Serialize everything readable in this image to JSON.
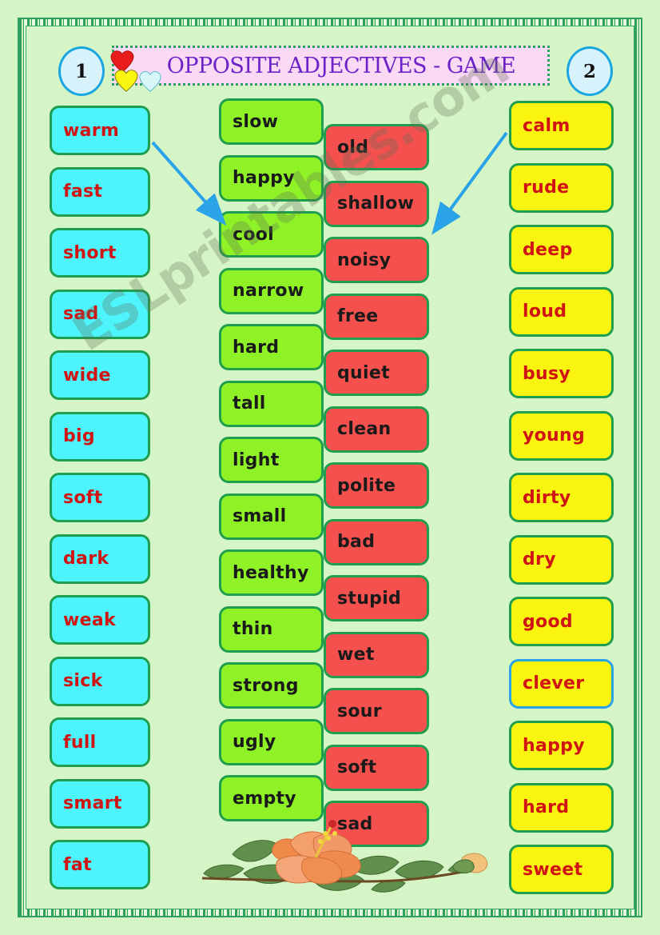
{
  "page": {
    "title": "OPPOSITE ADJECTIVES - GAME",
    "background_color": "#d6f5c6",
    "frame_color": "#2f9e5e",
    "watermark": "ESLprintables.com"
  },
  "header": {
    "title": "OPPOSITE ADJECTIVES - GAME",
    "title_color": "#6d21c9",
    "band_color": "#f9d9f4",
    "player_one": "1",
    "player_two": "2",
    "hearts": [
      {
        "name": "heart-red",
        "color": "#e81c1c"
      },
      {
        "name": "heart-yellow",
        "color": "#faf411"
      },
      {
        "name": "heart-white",
        "color": "#d8f7f9"
      }
    ]
  },
  "columns": [
    {
      "id": "column-cyan",
      "color": "#4df4fb",
      "text_color": "#d01414",
      "words": [
        "warm",
        "fast",
        "short",
        "sad",
        "wide",
        "big",
        "soft",
        "dark",
        "weak",
        "sick",
        "full",
        "smart",
        "fat"
      ]
    },
    {
      "id": "column-green",
      "color": "#8ef227",
      "text_color": "#1a1a1a",
      "words": [
        "slow",
        "happy",
        "cool",
        "narrow",
        "hard",
        "tall",
        "light",
        "small",
        "healthy",
        "thin",
        "strong",
        "ugly",
        "empty"
      ]
    },
    {
      "id": "column-red",
      "color": "#f4514e",
      "text_color": "#1a1a1a",
      "words": [
        "old",
        "shallow",
        "noisy",
        "free",
        "quiet",
        "clean",
        "polite",
        "bad",
        "stupid",
        "wet",
        "sour",
        "soft",
        "sad"
      ]
    },
    {
      "id": "column-yellow",
      "color": "#faf411",
      "text_color": "#d01414",
      "words": [
        "calm",
        "rude",
        "deep",
        "loud",
        "busy",
        "young",
        "dirty",
        "dry",
        "good",
        "clever",
        "happy",
        "hard",
        "sweet"
      ],
      "highlighted_word": "clever",
      "highlight_border_color": "#2aa3e8"
    }
  ],
  "arrows": [
    {
      "name": "arrow-warm-to-cool",
      "from": "warm",
      "to": "cool",
      "color": "#2aa3e8"
    },
    {
      "name": "arrow-calm-to-noisy",
      "from": "calm",
      "to": "noisy",
      "color": "#2aa3e8"
    }
  ],
  "decoration": {
    "flower": "hibiscus-flower-branch",
    "flower_color": "#f0873f",
    "leaf_color": "#5f8f4b"
  }
}
